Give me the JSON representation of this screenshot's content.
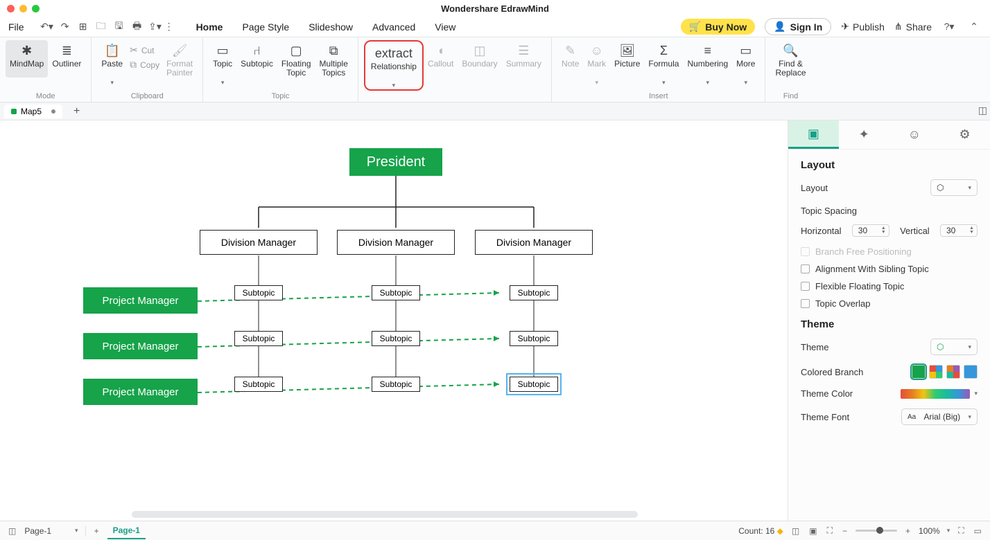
{
  "app_title": "Wondershare EdrawMind",
  "menubar": {
    "file": "File",
    "tabs": [
      "Home",
      "Page Style",
      "Slideshow",
      "Advanced",
      "View"
    ],
    "active_tab": "Home",
    "buy": "Buy Now",
    "signin": "Sign In",
    "publish": "Publish",
    "share": "Share"
  },
  "ribbon": {
    "mode": {
      "mindmap": "MindMap",
      "outliner": "Outliner",
      "label": "Mode"
    },
    "clipboard": {
      "paste": "Paste",
      "cut": "Cut",
      "copy": "Copy",
      "format": "Format\nPainter",
      "label": "Clipboard"
    },
    "topic": {
      "topic": "Topic",
      "subtopic": "Subtopic",
      "floating": "Floating\nTopic",
      "multiple": "Multiple\nTopics",
      "label": "Topic"
    },
    "relationship": "Relationship",
    "callout": "Callout",
    "boundary": "Boundary",
    "summary": "Summary",
    "insert": {
      "note": "Note",
      "mark": "Mark",
      "picture": "Picture",
      "formula": "Formula",
      "numbering": "Numbering",
      "more": "More",
      "label": "Insert"
    },
    "find": {
      "btn": "Find &\nReplace",
      "label": "Find"
    }
  },
  "doc_tab": {
    "name": "Map5"
  },
  "diagram": {
    "root": "President",
    "divisions": [
      "Division Manager",
      "Division Manager",
      "Division Manager"
    ],
    "pms": [
      "Project Manager",
      "Project Manager",
      "Project Manager"
    ],
    "subtopic": "Subtopic"
  },
  "panel": {
    "layout_h": "Layout",
    "layout_l": "Layout",
    "topic_spacing": "Topic Spacing",
    "horizontal": "Horizontal",
    "vertical": "Vertical",
    "h_val": "30",
    "v_val": "30",
    "branch_free": "Branch Free Positioning",
    "align_sibling": "Alignment With Sibling Topic",
    "flex_float": "Flexible Floating Topic",
    "overlap": "Topic Overlap",
    "theme_h": "Theme",
    "theme_l": "Theme",
    "colored_branch": "Colored Branch",
    "theme_color": "Theme Color",
    "theme_font": "Theme Font",
    "font_val": "Arial (Big)"
  },
  "status": {
    "page_sel": "Page-1",
    "page_active": "Page-1",
    "count_label": "Count:",
    "count_val": "16",
    "zoom": "100%"
  }
}
